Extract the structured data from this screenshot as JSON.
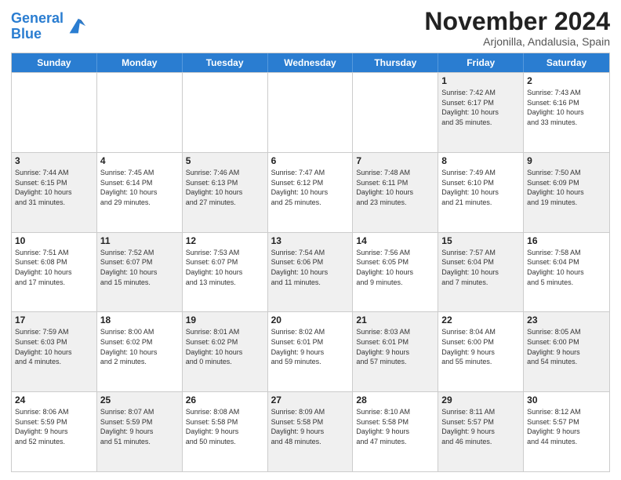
{
  "logo": {
    "line1": "General",
    "line2": "Blue"
  },
  "title": "November 2024",
  "subtitle": "Arjonilla, Andalusia, Spain",
  "weekdays": [
    "Sunday",
    "Monday",
    "Tuesday",
    "Wednesday",
    "Thursday",
    "Friday",
    "Saturday"
  ],
  "rows": [
    [
      {
        "day": "",
        "info": "",
        "shaded": false,
        "empty": true
      },
      {
        "day": "",
        "info": "",
        "shaded": false,
        "empty": true
      },
      {
        "day": "",
        "info": "",
        "shaded": false,
        "empty": true
      },
      {
        "day": "",
        "info": "",
        "shaded": false,
        "empty": true
      },
      {
        "day": "",
        "info": "",
        "shaded": false,
        "empty": true
      },
      {
        "day": "1",
        "info": "Sunrise: 7:42 AM\nSunset: 6:17 PM\nDaylight: 10 hours\nand 35 minutes.",
        "shaded": true,
        "empty": false
      },
      {
        "day": "2",
        "info": "Sunrise: 7:43 AM\nSunset: 6:16 PM\nDaylight: 10 hours\nand 33 minutes.",
        "shaded": false,
        "empty": false
      }
    ],
    [
      {
        "day": "3",
        "info": "Sunrise: 7:44 AM\nSunset: 6:15 PM\nDaylight: 10 hours\nand 31 minutes.",
        "shaded": true,
        "empty": false
      },
      {
        "day": "4",
        "info": "Sunrise: 7:45 AM\nSunset: 6:14 PM\nDaylight: 10 hours\nand 29 minutes.",
        "shaded": false,
        "empty": false
      },
      {
        "day": "5",
        "info": "Sunrise: 7:46 AM\nSunset: 6:13 PM\nDaylight: 10 hours\nand 27 minutes.",
        "shaded": true,
        "empty": false
      },
      {
        "day": "6",
        "info": "Sunrise: 7:47 AM\nSunset: 6:12 PM\nDaylight: 10 hours\nand 25 minutes.",
        "shaded": false,
        "empty": false
      },
      {
        "day": "7",
        "info": "Sunrise: 7:48 AM\nSunset: 6:11 PM\nDaylight: 10 hours\nand 23 minutes.",
        "shaded": true,
        "empty": false
      },
      {
        "day": "8",
        "info": "Sunrise: 7:49 AM\nSunset: 6:10 PM\nDaylight: 10 hours\nand 21 minutes.",
        "shaded": false,
        "empty": false
      },
      {
        "day": "9",
        "info": "Sunrise: 7:50 AM\nSunset: 6:09 PM\nDaylight: 10 hours\nand 19 minutes.",
        "shaded": true,
        "empty": false
      }
    ],
    [
      {
        "day": "10",
        "info": "Sunrise: 7:51 AM\nSunset: 6:08 PM\nDaylight: 10 hours\nand 17 minutes.",
        "shaded": false,
        "empty": false
      },
      {
        "day": "11",
        "info": "Sunrise: 7:52 AM\nSunset: 6:07 PM\nDaylight: 10 hours\nand 15 minutes.",
        "shaded": true,
        "empty": false
      },
      {
        "day": "12",
        "info": "Sunrise: 7:53 AM\nSunset: 6:07 PM\nDaylight: 10 hours\nand 13 minutes.",
        "shaded": false,
        "empty": false
      },
      {
        "day": "13",
        "info": "Sunrise: 7:54 AM\nSunset: 6:06 PM\nDaylight: 10 hours\nand 11 minutes.",
        "shaded": true,
        "empty": false
      },
      {
        "day": "14",
        "info": "Sunrise: 7:56 AM\nSunset: 6:05 PM\nDaylight: 10 hours\nand 9 minutes.",
        "shaded": false,
        "empty": false
      },
      {
        "day": "15",
        "info": "Sunrise: 7:57 AM\nSunset: 6:04 PM\nDaylight: 10 hours\nand 7 minutes.",
        "shaded": true,
        "empty": false
      },
      {
        "day": "16",
        "info": "Sunrise: 7:58 AM\nSunset: 6:04 PM\nDaylight: 10 hours\nand 5 minutes.",
        "shaded": false,
        "empty": false
      }
    ],
    [
      {
        "day": "17",
        "info": "Sunrise: 7:59 AM\nSunset: 6:03 PM\nDaylight: 10 hours\nand 4 minutes.",
        "shaded": true,
        "empty": false
      },
      {
        "day": "18",
        "info": "Sunrise: 8:00 AM\nSunset: 6:02 PM\nDaylight: 10 hours\nand 2 minutes.",
        "shaded": false,
        "empty": false
      },
      {
        "day": "19",
        "info": "Sunrise: 8:01 AM\nSunset: 6:02 PM\nDaylight: 10 hours\nand 0 minutes.",
        "shaded": true,
        "empty": false
      },
      {
        "day": "20",
        "info": "Sunrise: 8:02 AM\nSunset: 6:01 PM\nDaylight: 9 hours\nand 59 minutes.",
        "shaded": false,
        "empty": false
      },
      {
        "day": "21",
        "info": "Sunrise: 8:03 AM\nSunset: 6:01 PM\nDaylight: 9 hours\nand 57 minutes.",
        "shaded": true,
        "empty": false
      },
      {
        "day": "22",
        "info": "Sunrise: 8:04 AM\nSunset: 6:00 PM\nDaylight: 9 hours\nand 55 minutes.",
        "shaded": false,
        "empty": false
      },
      {
        "day": "23",
        "info": "Sunrise: 8:05 AM\nSunset: 6:00 PM\nDaylight: 9 hours\nand 54 minutes.",
        "shaded": true,
        "empty": false
      }
    ],
    [
      {
        "day": "24",
        "info": "Sunrise: 8:06 AM\nSunset: 5:59 PM\nDaylight: 9 hours\nand 52 minutes.",
        "shaded": false,
        "empty": false
      },
      {
        "day": "25",
        "info": "Sunrise: 8:07 AM\nSunset: 5:59 PM\nDaylight: 9 hours\nand 51 minutes.",
        "shaded": true,
        "empty": false
      },
      {
        "day": "26",
        "info": "Sunrise: 8:08 AM\nSunset: 5:58 PM\nDaylight: 9 hours\nand 50 minutes.",
        "shaded": false,
        "empty": false
      },
      {
        "day": "27",
        "info": "Sunrise: 8:09 AM\nSunset: 5:58 PM\nDaylight: 9 hours\nand 48 minutes.",
        "shaded": true,
        "empty": false
      },
      {
        "day": "28",
        "info": "Sunrise: 8:10 AM\nSunset: 5:58 PM\nDaylight: 9 hours\nand 47 minutes.",
        "shaded": false,
        "empty": false
      },
      {
        "day": "29",
        "info": "Sunrise: 8:11 AM\nSunset: 5:57 PM\nDaylight: 9 hours\nand 46 minutes.",
        "shaded": true,
        "empty": false
      },
      {
        "day": "30",
        "info": "Sunrise: 8:12 AM\nSunset: 5:57 PM\nDaylight: 9 hours\nand 44 minutes.",
        "shaded": false,
        "empty": false
      }
    ]
  ]
}
